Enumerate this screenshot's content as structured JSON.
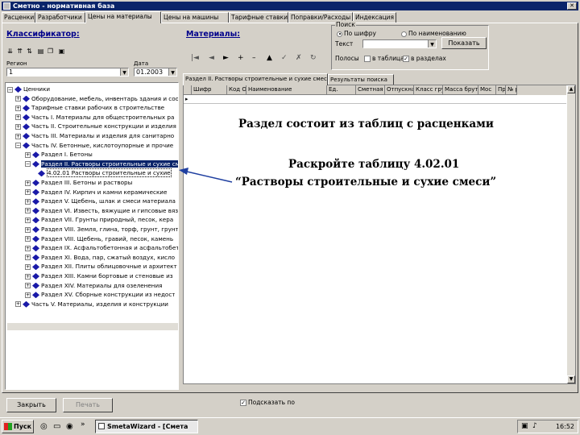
{
  "window": {
    "title": "Сметно - нормативная база"
  },
  "tabs": [
    {
      "label": "Расценки"
    },
    {
      "label": "Разработчики"
    },
    {
      "label": "Цены на материалы"
    },
    {
      "label": "Цены на машины"
    },
    {
      "label": "Тарифные ставки"
    },
    {
      "label": "Поправки/Расходы"
    },
    {
      "label": "Индексация"
    }
  ],
  "left": {
    "classifier_label": "Классификатор:",
    "region_label": "Регион",
    "region_value": "1",
    "date_label": "Дата",
    "date_value": "01.2003",
    "tree": [
      {
        "text": "Ценники",
        "exp": "-"
      },
      {
        "text": "Оборудование, мебель, инвентарь здания и соор",
        "exp": "+"
      },
      {
        "text": "Тарифные ставки рабочих в строительстве",
        "exp": "+"
      },
      {
        "text": "Часть I. Материалы для общестроительных ра",
        "exp": "+"
      },
      {
        "text": "Часть II. Строительные конструкции и изделия",
        "exp": "+"
      },
      {
        "text": "Часть III. Материалы и изделия для санитарно",
        "exp": "+"
      },
      {
        "text": "Часть IV. Бетонные, кислотоупорные и прочие",
        "exp": "-"
      },
      {
        "text": "Раздел I. Бетоны",
        "exp": "+"
      },
      {
        "text": "Раздел II. Растворы строительные и сухие сме",
        "exp": "-"
      },
      {
        "text": "4.02.01 Растворы строительные и сухие",
        "exp": ""
      },
      {
        "text": "Раздел III. Бетоны и растворы",
        "exp": "+"
      },
      {
        "text": "Раздел IV. Кирпич и камни керамические",
        "exp": "+"
      },
      {
        "text": "Раздел V. Щебень, шлак и смеси материала",
        "exp": "+"
      },
      {
        "text": "Раздел VI. Известь, вяжущие и гипсовые вяз",
        "exp": "+"
      },
      {
        "text": "Раздел VII. Грунты природный, песок, кера",
        "exp": "+"
      },
      {
        "text": "Раздел VIII. Земля, глина, торф, грунт, грунт",
        "exp": "+"
      },
      {
        "text": "Раздел VIII. Щебень, гравий, песок, камень",
        "exp": "+"
      },
      {
        "text": "Раздел IX. Асфальтобетонная и асфальтобето",
        "exp": "+"
      },
      {
        "text": "Раздел XI. Вода, пар, сжатый воздух, кисло",
        "exp": "+"
      },
      {
        "text": "Раздел XII. Плиты облицовочные и архитект",
        "exp": "+"
      },
      {
        "text": "Раздел XIII. Камни бортовые и стеновые из",
        "exp": "+"
      },
      {
        "text": "Раздел XIV. Материалы для озеленения",
        "exp": "+"
      },
      {
        "text": "Раздел XV. Сборные конструкции из недост",
        "exp": "+"
      },
      {
        "text": "Часть V. Материалы, изделия и конструкции",
        "exp": "+"
      }
    ]
  },
  "right": {
    "materials_label": "Материалы:",
    "search": {
      "legend": "Поиск",
      "by_code": "По шифру",
      "by_name": "По наименованию",
      "text_label": "Текст",
      "search_button": "Показать",
      "places_label": "Полосы",
      "in_tables": "в таблицах",
      "in_sections": "в разделах"
    },
    "subtabs": [
      {
        "label": "Раздел II. Растворы строительные и сухие смеси"
      },
      {
        "label": "Результаты поиска"
      }
    ],
    "columns": [
      "Шифр",
      "Код ОКП",
      "Наименование",
      "Ед.",
      "Сметная",
      "Отпускная",
      "Класс груза",
      "Масса брутто",
      "Мос",
      "Пр",
      "№ ресурса"
    ]
  },
  "notes": {
    "line1": "Раздел состоит из таблиц с расценками",
    "line2": "Раскройте таблицу 4.02.01",
    "line3": "“Растворы строительные и сухие смеси”"
  },
  "bottom": {
    "close_button": "Закрыть",
    "print_button": "Печать",
    "reference_checkbox": "Подсказать по"
  },
  "taskbar": {
    "start": "Пуск",
    "task_window": "SmetaWizard - [Смета",
    "clock": "16:52"
  }
}
